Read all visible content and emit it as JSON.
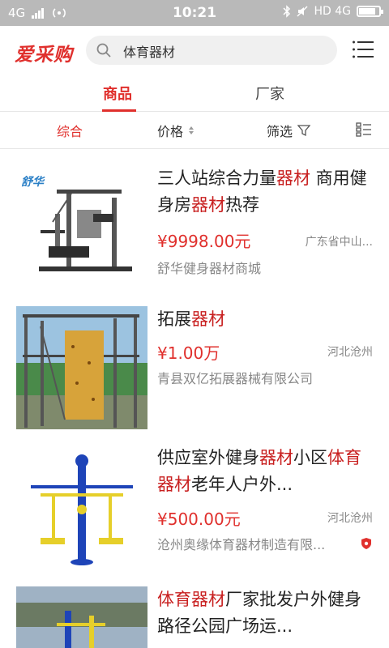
{
  "status_bar": {
    "network": "4G",
    "time": "10:21",
    "right_network": "HD 4G",
    "battery_percent": 90
  },
  "header": {
    "logo": "爱采购",
    "search_query": "体育器材"
  },
  "tabs": [
    {
      "label": "商品",
      "active": true
    },
    {
      "label": "厂家",
      "active": false
    }
  ],
  "filters": {
    "comprehensive": "综合",
    "price": "价格",
    "filter": "筛选"
  },
  "products": [
    {
      "title_parts": [
        {
          "text": "三人站综合力量",
          "hl": false
        },
        {
          "text": "器材",
          "hl": true
        },
        {
          "text": " 商用健身房",
          "hl": false
        },
        {
          "text": "器材",
          "hl": true
        },
        {
          "text": "热荐",
          "hl": false
        }
      ],
      "price": "¥9998.00元",
      "region": "广东省中山...",
      "shop": "舒华健身器材商城",
      "brand_mark": "舒华"
    },
    {
      "title_parts": [
        {
          "text": "拓展",
          "hl": false
        },
        {
          "text": "器材",
          "hl": true
        }
      ],
      "price": "¥1.00万",
      "region": "河北沧州",
      "shop": "青县双亿拓展器械有限公司",
      "brand_mark": ""
    },
    {
      "title_parts": [
        {
          "text": "供应室外健身",
          "hl": false
        },
        {
          "text": "器材",
          "hl": true
        },
        {
          "text": "小区",
          "hl": false
        },
        {
          "text": "体育器材",
          "hl": true
        },
        {
          "text": "老年人户外...",
          "hl": false
        }
      ],
      "price": "¥500.00元",
      "region": "河北沧州",
      "shop": "沧州奥缘体育器材制造有限...",
      "brand_mark": ""
    },
    {
      "title_parts": [
        {
          "text": "体育器材",
          "hl": true
        },
        {
          "text": "厂家批发户外健身路径公园广场运...",
          "hl": false
        }
      ],
      "price": "",
      "region": "",
      "shop": "",
      "brand_mark": ""
    }
  ],
  "colors": {
    "accent": "#e0302d",
    "highlight": "#c81f1f",
    "statusbar": "#b9b9b9"
  },
  "icons": [
    "search-icon",
    "menu-icon",
    "sort-icon",
    "filter-funnel-icon",
    "list-view-icon",
    "shield-badge-icon"
  ]
}
